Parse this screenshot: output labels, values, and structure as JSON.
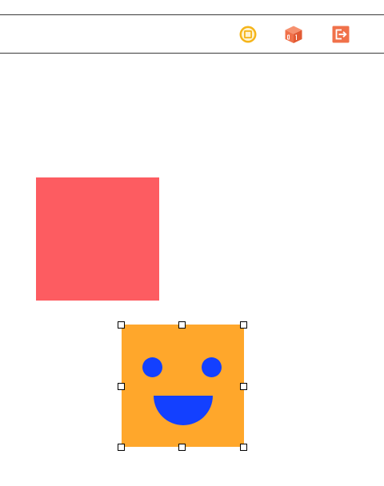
{
  "toolbar": {
    "items": [
      {
        "icon": "view-controller-icon",
        "color": "#f5b51b"
      },
      {
        "icon": "first-responder-cube-icon",
        "color": "#f0714a"
      },
      {
        "icon": "exit-icon",
        "color": "#f0714a"
      }
    ]
  },
  "canvas": {
    "views": [
      {
        "name": "red-square-view",
        "color": "#fd5c61"
      },
      {
        "name": "smiley-face-view",
        "color": "#ffa72b",
        "feature_color": "#1340ff",
        "selected": true
      }
    ]
  }
}
